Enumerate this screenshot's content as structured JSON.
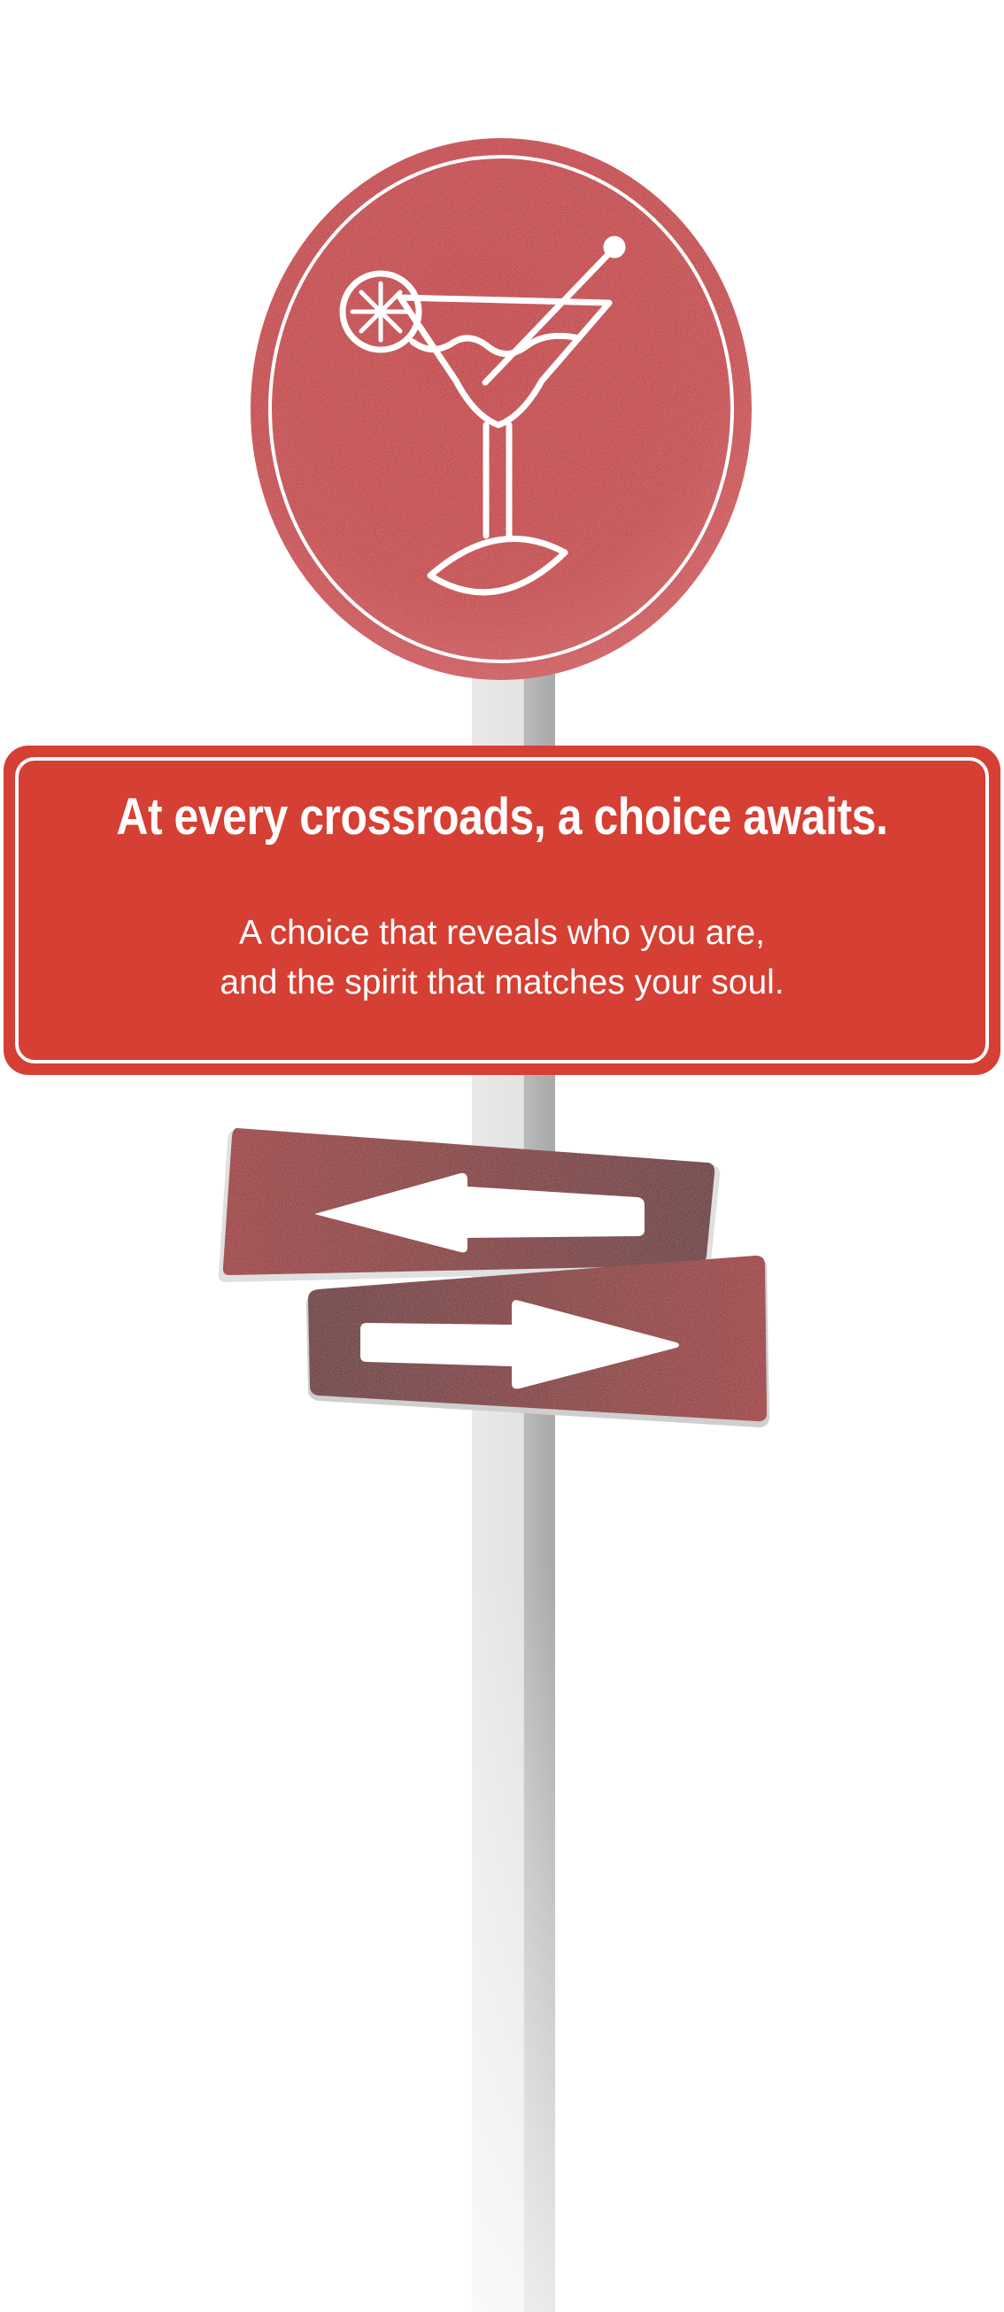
{
  "sign": {
    "headline": "At every crossroads, a choice awaits.",
    "subline_1": "A choice that reveals who you are,",
    "subline_2": "and the spirit that matches your soul."
  },
  "icons": {
    "emblem": "cocktail-glass-icon",
    "left_sign": "arrow-left-icon",
    "right_sign": "arrow-right-icon"
  },
  "colors": {
    "sign_red": "#d63f33",
    "emblem_red": "#c6262b",
    "arrow_sign_dark": "#6f1014",
    "arrow_sign_light": "#98171d",
    "pole_gray": "#d7d7d7"
  }
}
